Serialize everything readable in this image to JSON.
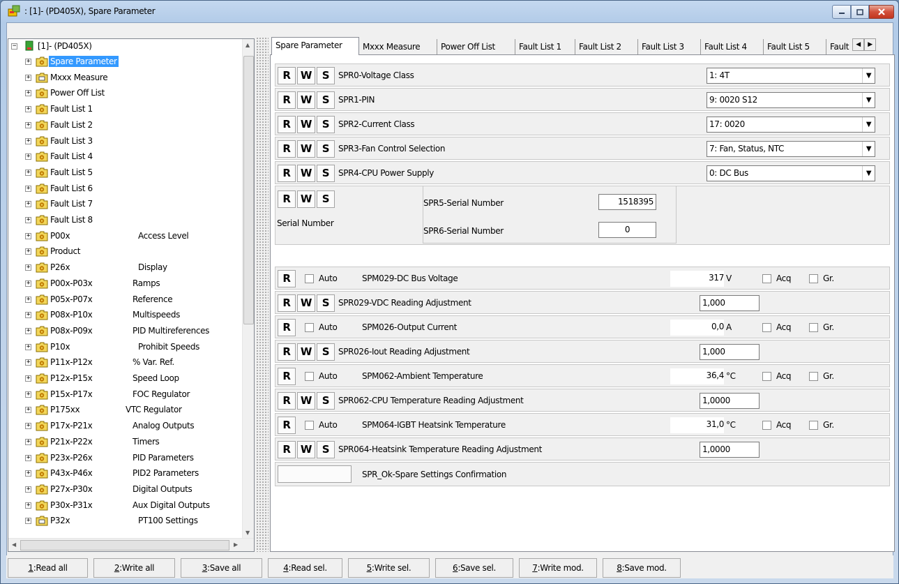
{
  "window": {
    "title": ": [1]- (PD405X), Spare Parameter"
  },
  "tree": {
    "root": "[1]- (PD405X)",
    "items": [
      {
        "label": "Spare Parameter",
        "desc": ""
      },
      {
        "label": "Mxxx Measure",
        "desc": ""
      },
      {
        "label": "Power Off List",
        "desc": ""
      },
      {
        "label": "Fault List 1",
        "desc": ""
      },
      {
        "label": "Fault List 2",
        "desc": ""
      },
      {
        "label": "Fault List 3",
        "desc": ""
      },
      {
        "label": "Fault List 4",
        "desc": ""
      },
      {
        "label": "Fault List 5",
        "desc": ""
      },
      {
        "label": "Fault List 6",
        "desc": ""
      },
      {
        "label": "Fault List 7",
        "desc": ""
      },
      {
        "label": "Fault List 8",
        "desc": ""
      },
      {
        "label": "P00x",
        "desc": "Access Level"
      },
      {
        "label": "Product",
        "desc": ""
      },
      {
        "label": "P26x",
        "desc": "Display"
      },
      {
        "label": "P00x-P03x",
        "desc": "Ramps"
      },
      {
        "label": "P05x-P07x",
        "desc": "Reference"
      },
      {
        "label": "P08x-P10x",
        "desc": "Multispeeds"
      },
      {
        "label": "P08x-P09x",
        "desc": "PID Multireferences"
      },
      {
        "label": "P10x",
        "desc": "Prohibit Speeds"
      },
      {
        "label": "P11x-P12x",
        "desc": "% Var. Ref."
      },
      {
        "label": "P12x-P15x",
        "desc": "Speed Loop"
      },
      {
        "label": "P15x-P17x",
        "desc": "FOC Regulator"
      },
      {
        "label": "P175xx",
        "desc": "VTC Regulator"
      },
      {
        "label": "P17x-P21x",
        "desc": "Analog Outputs"
      },
      {
        "label": "P21x-P22x",
        "desc": "Timers"
      },
      {
        "label": "P23x-P26x",
        "desc": "PID Parameters"
      },
      {
        "label": "P43x-P46x",
        "desc": "PID2 Parameters"
      },
      {
        "label": "P27x-P30x",
        "desc": "Digital Outputs"
      },
      {
        "label": "P30x-P31x",
        "desc": "Aux Digital Outputs"
      },
      {
        "label": "P32x",
        "desc": "PT100 Settings"
      }
    ]
  },
  "tabs": [
    "Spare Parameter",
    "Mxxx Measure",
    "Power Off List",
    "Fault List 1",
    "Fault List 2",
    "Fault List 3",
    "Fault List 4",
    "Fault List 5",
    "Fault"
  ],
  "buttons": {
    "r": "R",
    "w": "W",
    "s": "S"
  },
  "rows": {
    "spr0": {
      "label": "SPR0-Voltage Class",
      "value": "1: 4T"
    },
    "spr1": {
      "label": "SPR1-PIN",
      "value": "9: 0020 S12"
    },
    "spr2": {
      "label": "SPR2-Current Class",
      "value": "17: 0020"
    },
    "spr3": {
      "label": "SPR3-Fan Control Selection",
      "value": "7: Fan, Status, NTC"
    },
    "spr4": {
      "label": "SPR4-CPU Power Supply",
      "value": "0: DC Bus"
    },
    "serial": {
      "group": "Serial Number",
      "spr5_label": "SPR5-Serial Number",
      "spr5_value": "1518395",
      "spr6_label": "SPR6-Serial Number",
      "spr6_value": "0"
    },
    "spm029": {
      "label": "SPM029-DC Bus Voltage",
      "value": "317",
      "unit": "V"
    },
    "spr029": {
      "label": "SPR029-VDC Reading Adjustment",
      "value": "1,000"
    },
    "spm026": {
      "label": "SPM026-Output Current",
      "value": "0,0",
      "unit": "A"
    },
    "spr026": {
      "label": "SPR026-Iout Reading Adjustment",
      "value": "1,000"
    },
    "spm062": {
      "label": "SPM062-Ambient Temperature",
      "value": "36,4",
      "unit": "°C"
    },
    "spr062": {
      "label": "SPR062-CPU Temperature Reading Adjustment",
      "value": "1,0000"
    },
    "spm064": {
      "label": "SPM064-IGBT Heatsink Temperature",
      "value": "31,0",
      "unit": "°C"
    },
    "spr064": {
      "label": "SPR064-Heatsink Temperature Reading Adjustment",
      "value": "1,0000"
    },
    "ok": {
      "label": "SPR_Ok-Spare Settings Confirmation"
    }
  },
  "checks": {
    "auto": "Auto",
    "acq": "Acq",
    "gr": "Gr."
  },
  "bottom": [
    {
      "key": "1",
      "rest": ":Read all"
    },
    {
      "key": "2",
      "rest": ":Write all"
    },
    {
      "key": "3",
      "rest": ":Save all"
    },
    {
      "key": "4",
      "rest": ":Read sel."
    },
    {
      "key": "5",
      "rest": ":Write sel."
    },
    {
      "key": "6",
      "rest": ":Save sel."
    },
    {
      "key": "7",
      "rest": ":Write mod."
    },
    {
      "key": "8",
      "rest": ":Save mod."
    }
  ]
}
